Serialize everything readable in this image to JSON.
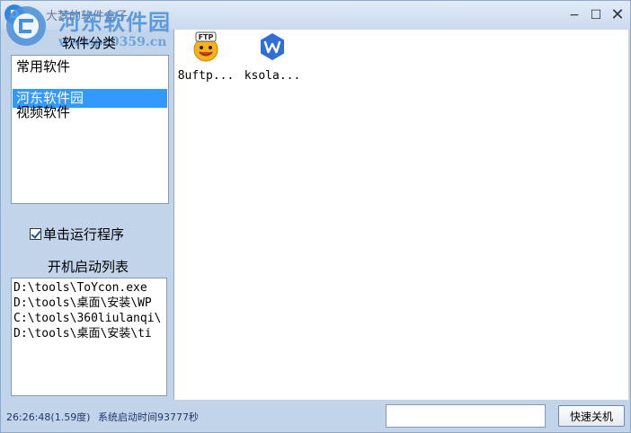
{
  "window": {
    "title": "大梦的软件盒子",
    "controls": {
      "minimize": "−",
      "maximize": "☐",
      "close": "✕"
    }
  },
  "watermark": {
    "name": "河东软件园",
    "url": "www.pc0359.cn"
  },
  "sidebar": {
    "category_title": "软件分类",
    "categories": [
      {
        "label": "常用软件",
        "selected": false
      },
      {
        "label": "河东软件园",
        "selected": true
      },
      {
        "label": "视频软件",
        "selected": false
      }
    ],
    "run_on_single_click": {
      "label": "单击运行程序",
      "checked": true
    },
    "startup_title": "开机启动列表",
    "startup_items": [
      "D:\\tools\\ToYcon.exe",
      "D:\\tools\\桌面\\安装\\WP",
      "C:\\tools\\360liulanqi\\",
      "D:\\tools\\桌面\\安装\\ti"
    ]
  },
  "content": {
    "apps": [
      {
        "label": "8uftp...",
        "icon": "ftp-smiley-icon"
      },
      {
        "label": "ksola...",
        "icon": "wps-office-icon"
      }
    ]
  },
  "statusbar": {
    "time": "26:26:48(1.59度)",
    "boot_time": "系统启动时间93777秒",
    "input_value": "",
    "shutdown_label": "快速关机"
  },
  "colors": {
    "frame": "#c2d4ea",
    "selection": "#3399ff",
    "watermark": "#4a8fd8"
  }
}
